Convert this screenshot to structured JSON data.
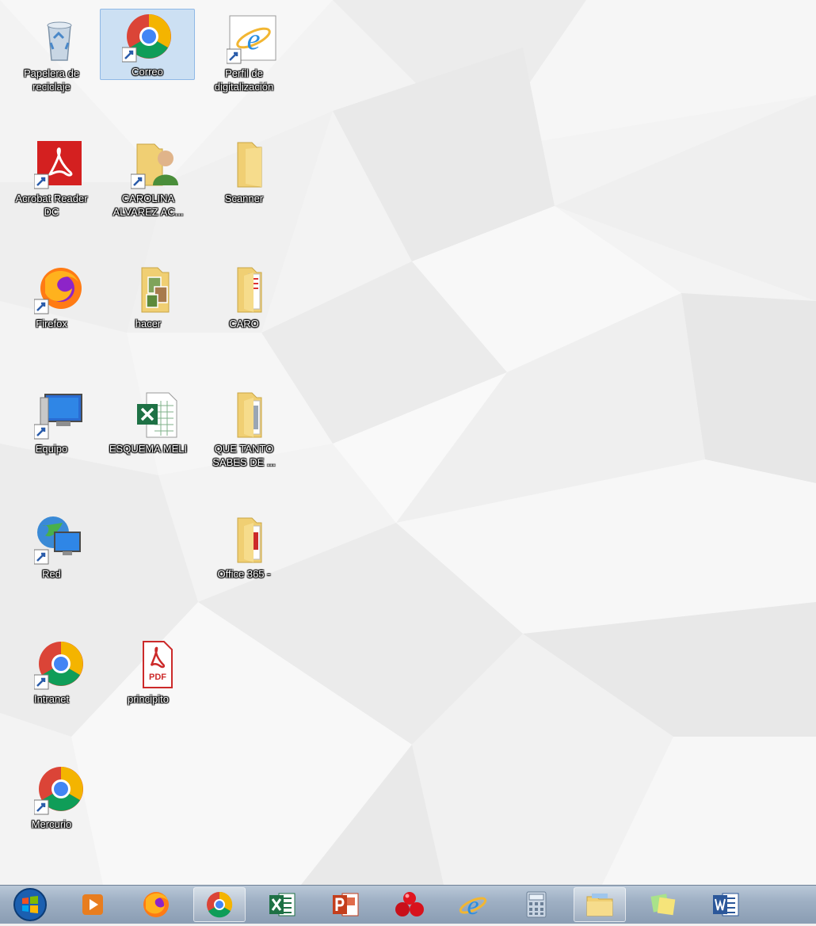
{
  "desktop": {
    "icons": [
      {
        "label": "Papelera de reciclaje",
        "icon": "recycle-bin-icon"
      },
      {
        "label": "Correo",
        "icon": "chrome-shortcut-icon",
        "selected": true
      },
      {
        "label": "Perfil de digitalización",
        "icon": "internet-explorer-shortcut-icon"
      },
      {
        "label": "Acrobat Reader DC",
        "icon": "acrobat-reader-shortcut-icon"
      },
      {
        "label": "CAROLINA ALVAREZ AC...",
        "icon": "user-folder-shortcut-icon"
      },
      {
        "label": "Scanner",
        "icon": "folder-icon"
      },
      {
        "label": "Firefox",
        "icon": "firefox-shortcut-icon"
      },
      {
        "label": "hacer",
        "icon": "folder-with-photos-icon"
      },
      {
        "label": "CARO",
        "icon": "folder-with-documents-icon"
      },
      {
        "label": "Equipo",
        "icon": "computer-shortcut-icon"
      },
      {
        "label": "ESQUEMA MELI",
        "icon": "excel-file-icon"
      },
      {
        "label": "QUE TANTO SABES DE ...",
        "icon": "folder-with-documents-icon"
      },
      {
        "label": "Red",
        "icon": "network-shortcut-icon"
      },
      {
        "label": "Office 365 -",
        "icon": "folder-with-documents-icon"
      },
      {
        "label": "Intranet",
        "icon": "chrome-shortcut-icon"
      },
      {
        "label": "principito",
        "icon": "pdf-file-icon"
      },
      {
        "label": "Mercurio",
        "icon": "chrome-shortcut-icon"
      }
    ]
  },
  "taskbar": {
    "items": [
      {
        "icon": "start-orb-icon"
      },
      {
        "icon": "media-player-icon"
      },
      {
        "icon": "firefox-icon"
      },
      {
        "icon": "chrome-icon",
        "active": true
      },
      {
        "icon": "excel-icon"
      },
      {
        "icon": "powerpoint-icon"
      },
      {
        "icon": "red-balls-app-icon"
      },
      {
        "icon": "internet-explorer-icon"
      },
      {
        "icon": "calculator-icon"
      },
      {
        "icon": "file-explorer-icon",
        "active": true
      },
      {
        "icon": "sticky-notes-icon"
      },
      {
        "icon": "word-icon"
      }
    ]
  },
  "colors": {
    "taskbar": "#9fb0c4",
    "selection": "#cfe3f7",
    "label_text": "#ffffff"
  }
}
